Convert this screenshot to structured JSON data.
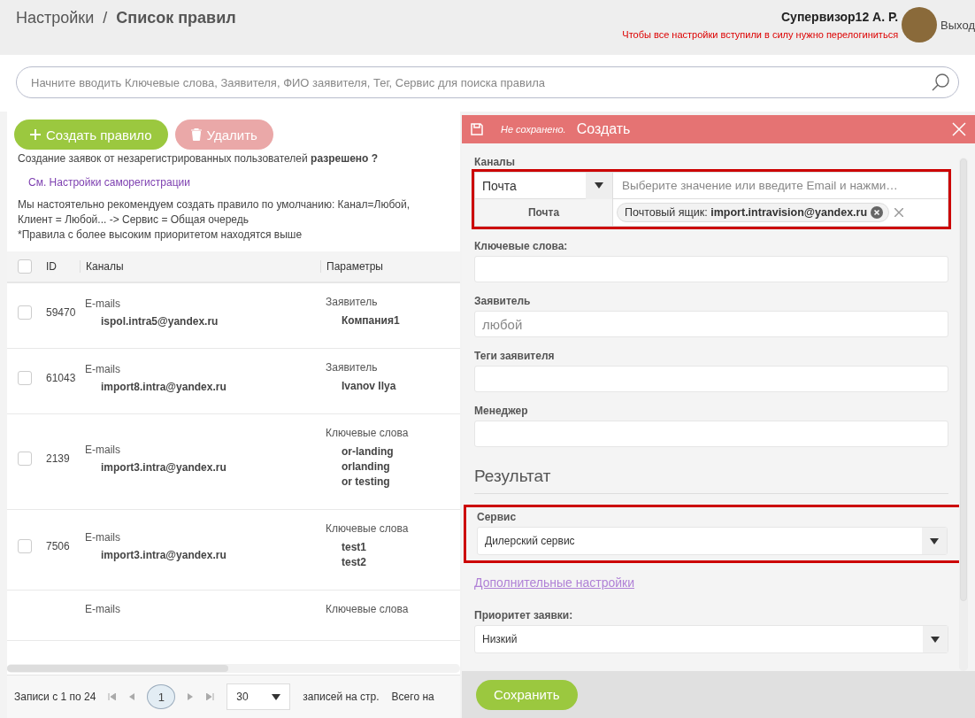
{
  "header": {
    "parent": "Настройки",
    "separator": "/",
    "title": "Список правил",
    "user_name": "Супервизор12 А. Р.",
    "notice": "Чтобы все настройки вступили в силу нужно перелогиниться",
    "logout": "Выход"
  },
  "search": {
    "placeholder": "Начните вводить Ключевые слова, Заявителя, ФИО заявителя, Тег, Сервис для поиска правила"
  },
  "actions": [
    {
      "label": "Создать правило",
      "kind": "create",
      "disabled": false
    },
    {
      "label": "Удалить",
      "kind": "delete",
      "disabled": true
    }
  ],
  "info": {
    "registration": "Создание заявок от незарегистрированных пользователей **разрешено ?**",
    "registration_link": "См. Настройки саморегистрации",
    "recommendation": "Мы настоятельно рекомендуем создать правило по умолчанию: Канал=Любой, Клиент = Любой... -> Сервис = Общая очередь",
    "priority_note": "*Правила с более высоким приоритетом находятся выше"
  },
  "table": {
    "columns": [
      "ID",
      "Каналы",
      "Параметры"
    ],
    "all_checked": false,
    "rows": [
      {
        "checked": false,
        "id": "59470",
        "channel_type": "E-mails",
        "channel_value": "ispol.intra5@yandex.ru",
        "param_type": "Заявитель",
        "param_values": [
          "Компания1"
        ]
      },
      {
        "checked": false,
        "id": "61043",
        "channel_type": "E-mails",
        "channel_value": "import8.intra@yandex.ru",
        "param_type": "Заявитель",
        "param_values": [
          "Ivanov Ilya"
        ]
      },
      {
        "checked": false,
        "id": "2139",
        "channel_type": "E-mails",
        "channel_value": "import3.intra@yandex.ru",
        "param_type": "Ключевые слова",
        "param_values": [
          "or-landing",
          "orlanding",
          "or testing"
        ]
      },
      {
        "checked": false,
        "id": "7506",
        "channel_type": "E-mails",
        "channel_value": "import3.intra@yandex.ru",
        "param_type": "Ключевые слова",
        "param_values": [
          "test1",
          "test2"
        ]
      },
      {
        "channel_type": "E-mails",
        "param_type": "Ключевые слова"
      }
    ]
  },
  "pagination": {
    "range": "Записи с 1 по 24",
    "pages": [
      {
        "label": "1",
        "selected": true
      }
    ],
    "page_size": "30",
    "per_page": "записей на стр.",
    "total": "Всего на"
  },
  "editor": {
    "status": "Не сохранено.",
    "title": "Создать",
    "channels": {
      "label": "Каналы",
      "highlighted": true,
      "type": "Почта",
      "placeholder": "Выберите значение или введите Email и нажми…",
      "row_label": "Почта",
      "tag": "Почтовый ящик: **import.intravision@yandex.ru**"
    },
    "fields": [
      {
        "label": "Ключевые слова:"
      },
      {
        "label": "Заявитель",
        "placeholder": "любой"
      },
      {
        "label": "Теги заявителя"
      },
      {
        "label": "Менеджер"
      }
    ],
    "result_heading": "Результат",
    "service": {
      "label": "Сервис",
      "value": "Дилерский сервис",
      "highlighted": true
    },
    "more_link": "Дополнительные настройки",
    "priority": {
      "label": "Приоритет заявки:",
      "value": "Низкий",
      "highlighted": false
    },
    "save": "Сохранить"
  }
}
